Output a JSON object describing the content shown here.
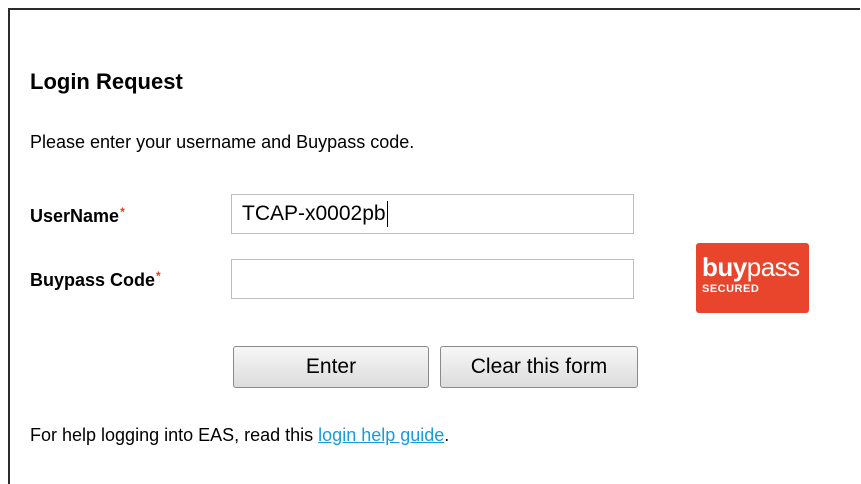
{
  "form": {
    "title": "Login Request",
    "intro": "Please enter your username and Buypass code.",
    "required_mark": "*",
    "username": {
      "label": "UserName",
      "value": "TCAP-x0002pb"
    },
    "buypass_code": {
      "label": "Buypass Code",
      "value": ""
    },
    "enter_label": "Enter",
    "clear_label": "Clear this form"
  },
  "help": {
    "prefix": "For help logging into EAS, read this ",
    "link_text": "login help guide",
    "suffix": "."
  },
  "logo": {
    "brand_bold": "buy",
    "brand_light": "pass",
    "tagline": "SECURED",
    "color": "#e8452c"
  },
  "colors": {
    "required": "#e03c20",
    "link": "#1a9bd7"
  }
}
